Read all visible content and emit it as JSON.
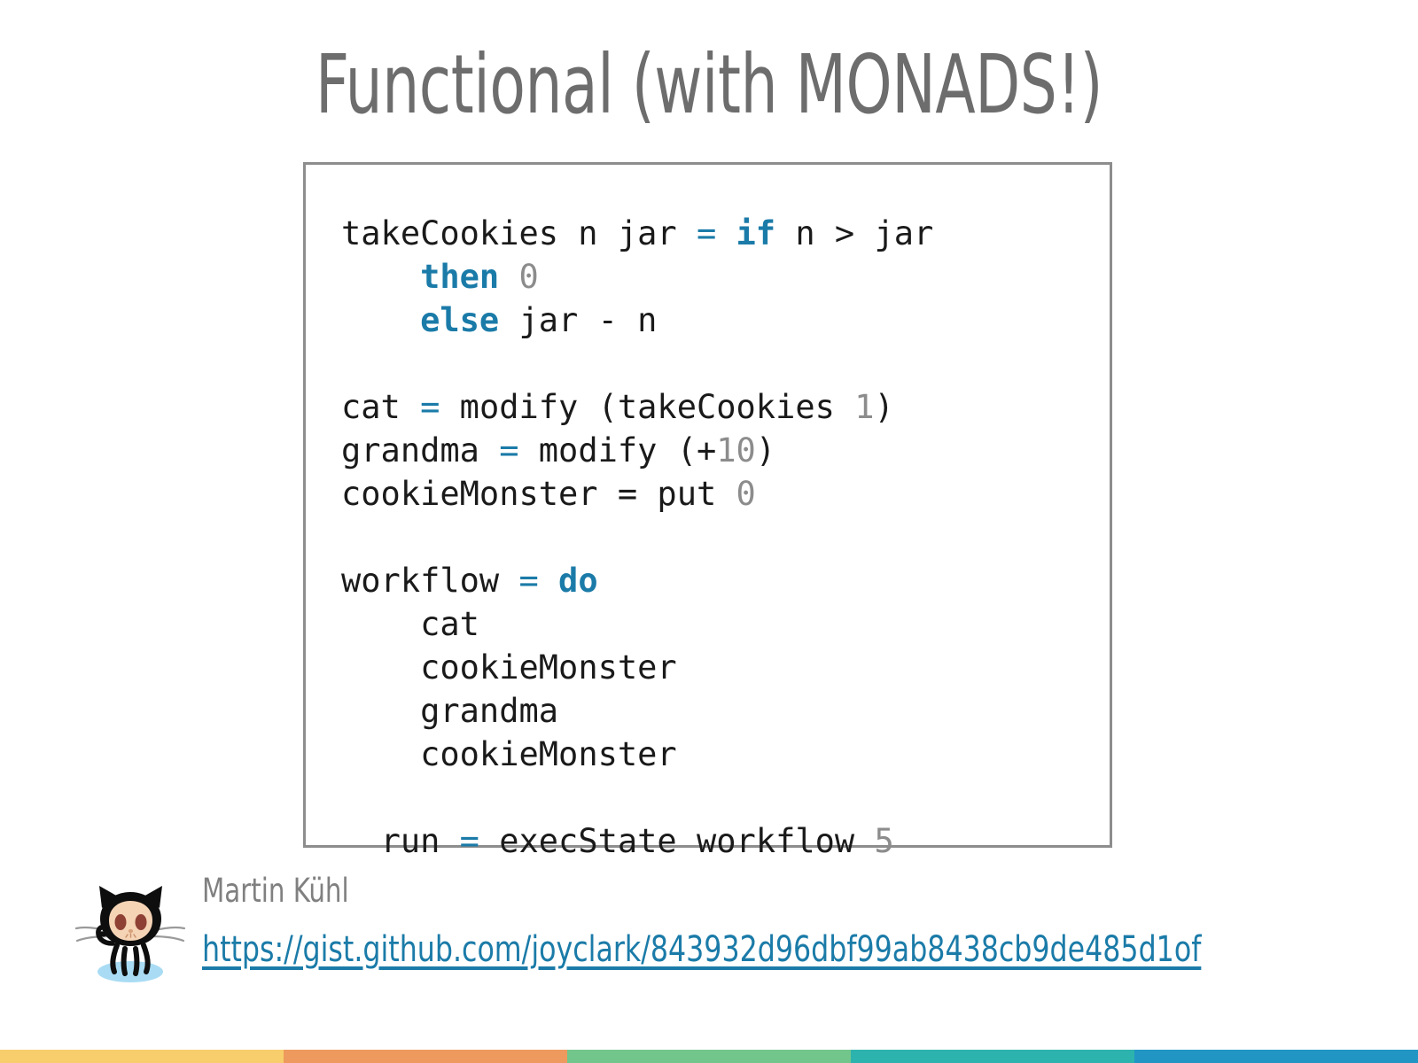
{
  "slide": {
    "title": "Functional (with MONADS!)"
  },
  "code": {
    "language": "haskell",
    "lines": [
      {
        "indent": 0,
        "tokens": [
          {
            "t": "takeCookies n jar ",
            "k": "plain"
          },
          {
            "t": "=",
            "k": "op"
          },
          {
            "t": " ",
            "k": "plain"
          },
          {
            "t": "if",
            "k": "kw"
          },
          {
            "t": " n > jar",
            "k": "plain"
          }
        ]
      },
      {
        "indent": 2,
        "tokens": [
          {
            "t": "then",
            "k": "kw"
          },
          {
            "t": " ",
            "k": "plain"
          },
          {
            "t": "0",
            "k": "num"
          }
        ]
      },
      {
        "indent": 2,
        "tokens": [
          {
            "t": "else",
            "k": "kw"
          },
          {
            "t": " jar - n",
            "k": "plain"
          }
        ]
      },
      {
        "indent": 0,
        "tokens": []
      },
      {
        "indent": 0,
        "tokens": [
          {
            "t": "cat ",
            "k": "plain"
          },
          {
            "t": "=",
            "k": "op"
          },
          {
            "t": " modify (takeCookies ",
            "k": "plain"
          },
          {
            "t": "1",
            "k": "num"
          },
          {
            "t": ")",
            "k": "plain"
          }
        ]
      },
      {
        "indent": 0,
        "tokens": [
          {
            "t": "grandma ",
            "k": "plain"
          },
          {
            "t": "=",
            "k": "op"
          },
          {
            "t": " modify (+",
            "k": "plain"
          },
          {
            "t": "10",
            "k": "num"
          },
          {
            "t": ")",
            "k": "plain"
          }
        ]
      },
      {
        "indent": 0,
        "tokens": [
          {
            "t": "cookieMonster = put ",
            "k": "plain"
          },
          {
            "t": "0",
            "k": "num"
          }
        ]
      },
      {
        "indent": 0,
        "tokens": []
      },
      {
        "indent": 0,
        "tokens": [
          {
            "t": "workflow ",
            "k": "plain"
          },
          {
            "t": "=",
            "k": "op"
          },
          {
            "t": " ",
            "k": "plain"
          },
          {
            "t": "do",
            "k": "kw"
          }
        ]
      },
      {
        "indent": 2,
        "tokens": [
          {
            "t": "cat",
            "k": "plain"
          }
        ]
      },
      {
        "indent": 2,
        "tokens": [
          {
            "t": "cookieMonster",
            "k": "plain"
          }
        ]
      },
      {
        "indent": 2,
        "tokens": [
          {
            "t": "grandma",
            "k": "plain"
          }
        ]
      },
      {
        "indent": 2,
        "tokens": [
          {
            "t": "cookieMonster",
            "k": "plain"
          }
        ]
      },
      {
        "indent": 0,
        "tokens": []
      },
      {
        "indent": 1,
        "tokens": [
          {
            "t": "run ",
            "k": "plain"
          },
          {
            "t": "=",
            "k": "op"
          },
          {
            "t": " execState workflow ",
            "k": "plain"
          },
          {
            "t": "5",
            "k": "num"
          }
        ]
      }
    ]
  },
  "footer": {
    "author": "Martin Kühl",
    "gist_url": "https://gist.github.com/joyclark/843932d96dbf99ab8438cb9de485d1of",
    "logo_icon": "github-octocat-icon"
  },
  "colors": {
    "title_gray": "#6d6d6d",
    "keyword_teal": "#1b7ba8",
    "number_gray": "#8c8c8c",
    "code_text": "#1a1a1a",
    "code_border": "#8d8d8d",
    "link_blue": "#1b7ba8",
    "author_gray": "#808080",
    "bar_yellow": "#f7ce6b",
    "bar_orange": "#ee9a5e",
    "bar_green": "#73c68b",
    "bar_teal": "#2db3ad",
    "bar_blue": "#2196c4"
  },
  "color_bar": {
    "segments": [
      {
        "name": "yellow",
        "hex": "#f7ce6b"
      },
      {
        "name": "orange",
        "hex": "#ee9a5e"
      },
      {
        "name": "green",
        "hex": "#73c68b"
      },
      {
        "name": "teal",
        "hex": "#2db3ad"
      },
      {
        "name": "blue",
        "hex": "#2196c4"
      }
    ]
  }
}
